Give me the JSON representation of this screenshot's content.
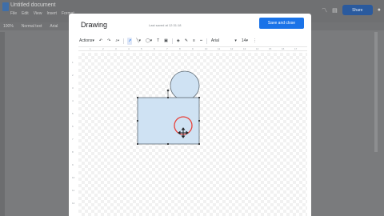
{
  "background_app": {
    "doc_title": "Untitled document",
    "menu": [
      "File",
      "Edit",
      "View",
      "Insert",
      "Format"
    ],
    "toolbar": [
      "100%",
      "Normal text",
      "Arial"
    ],
    "share_label": "Share"
  },
  "dialog": {
    "title": "Drawing",
    "status": "Last saved at 12:31:18",
    "save_label": "Save and close"
  },
  "toolbar": {
    "actions": "Actions",
    "font": "Arial",
    "font_size": "14",
    "icons": [
      "undo-icon",
      "redo-icon",
      "zoom-icon",
      "select-icon",
      "line-icon",
      "shape-icon",
      "image-icon",
      "text-box-icon",
      "fill-color-icon",
      "border-color-icon",
      "border-weight-icon",
      "border-dash-icon",
      "more-icon"
    ]
  },
  "ruler": {
    "horizontal": [
      "1",
      "2",
      "3",
      "4",
      "5",
      "6",
      "7",
      "8",
      "9",
      "10",
      "11",
      "12",
      "13",
      "14",
      "15",
      "16",
      "17"
    ],
    "vertical": [
      "1",
      "2",
      "3",
      "4",
      "5",
      "6",
      "7",
      "8",
      "9",
      "10",
      "11",
      "12"
    ]
  },
  "colors": {
    "accent": "#1a73e8",
    "shape_fill": "#cfe2f3",
    "shape_stroke": "#5b6770",
    "highlight_circle": "#e8423b"
  }
}
